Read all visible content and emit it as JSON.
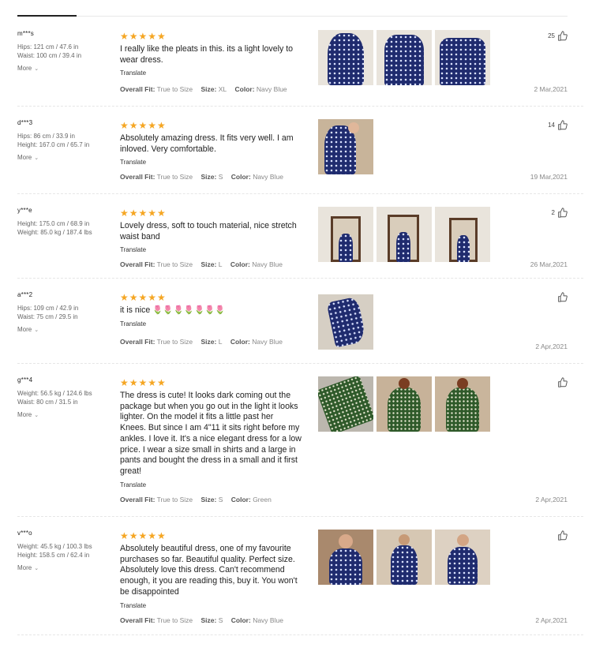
{
  "ui": {
    "star_glyphs": "★★★★★",
    "translate_label": "Translate",
    "more_label": "More",
    "overall_fit_key": "Overall Fit:",
    "size_key": "Size:",
    "color_key": "Color:"
  },
  "reviews": [
    {
      "user": "m***s",
      "attrs": [
        "Hips: 121 cm / 47.6 in",
        "Waist: 100 cm / 39.4 in"
      ],
      "more": true,
      "text": "I really like the pleats in this. its a light lovely to wear dress.",
      "fit": "True to Size",
      "size": "XL",
      "color": "Navy Blue",
      "likes": "25",
      "date": "2 Mar,2021"
    },
    {
      "user": "d***3",
      "attrs": [
        "Hips: 86 cm / 33.9 in",
        "Height: 167.0 cm / 65.7 in"
      ],
      "more": true,
      "text": "Absolutely amazing dress. It fits very well. I am inloved. Very comfortable.",
      "fit": "True to Size",
      "size": "S",
      "color": "Navy Blue",
      "likes": "14",
      "date": "19 Mar,2021"
    },
    {
      "user": "y***e",
      "attrs": [
        "Height: 175.0 cm / 68.9 in",
        "Weight: 85.0 kg / 187.4 lbs"
      ],
      "more": false,
      "text": "Lovely dress, soft to touch material, nice stretch waist band",
      "fit": "True to Size",
      "size": "L",
      "color": "Navy Blue",
      "likes": "2",
      "date": "26 Mar,2021"
    },
    {
      "user": "a***2",
      "attrs": [
        "Hips: 109 cm / 42.9 in",
        "Waist: 75 cm / 29.5 in"
      ],
      "more": true,
      "text": "it is nice 🌷🌷🌷🌷🌷🌷🌷",
      "fit": "True to Size",
      "size": "L",
      "color": "Navy Blue",
      "likes": "",
      "date": "2 Apr,2021"
    },
    {
      "user": "g***4",
      "attrs": [
        "Weight: 56.5 kg / 124.6 lbs",
        "Waist: 80 cm / 31.5 in"
      ],
      "more": true,
      "text": "The dress is cute! It looks dark coming out the package but when you go out in the light it looks lighter. On the model it fits a little past her Knees. But since I am 4\"11 it sits right before my ankles. I love it. It's a nice elegant dress for a low price. I wear a size small in shirts and a large in pants and bought the dress in a small and it first great!",
      "fit": "True to Size",
      "size": "S",
      "color": "Green",
      "likes": "",
      "date": "2 Apr,2021"
    },
    {
      "user": "v***o",
      "attrs": [
        "Weight: 45.5 kg / 100.3 lbs",
        "Height: 158.5 cm / 62.4 in"
      ],
      "more": true,
      "text": "Absolutely beautiful dress, one of my favourite purchases so far. Beautiful quality. Perfect size. Absolutely love this dress. Can't recommend enough, it you are reading this, buy it. You won't be disappointed",
      "fit": "True to Size",
      "size": "S",
      "color": "Navy Blue",
      "likes": "",
      "date": "2 Apr,2021"
    }
  ],
  "colors": {
    "star": "#f5a623",
    "navy": "#1f2b6e",
    "green": "#2f5a2a"
  }
}
